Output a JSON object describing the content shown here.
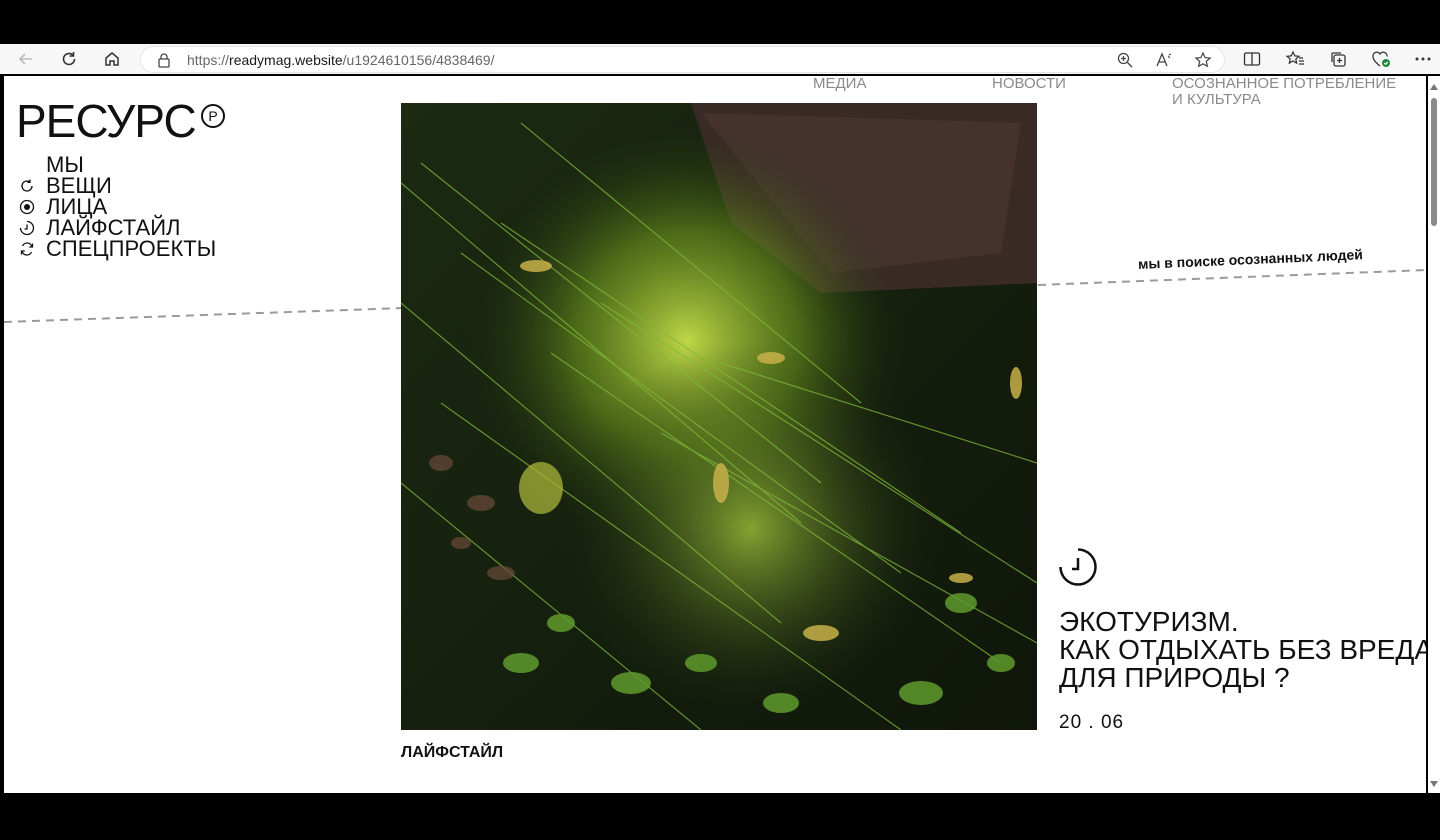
{
  "browser": {
    "url_prefix": "https://",
    "url_domain": "readymag.website",
    "url_path": "/u1924610156/4838469/",
    "icons": [
      "back-icon",
      "reload-icon",
      "home-icon",
      "lock-icon",
      "zoom-icon",
      "read-aloud-icon",
      "favorite-star-icon",
      "split-screen-icon",
      "favorites-icon",
      "collections-icon",
      "browser-essentials-icon",
      "more-icon"
    ]
  },
  "site": {
    "logo": "РЕСУРС",
    "logo_mark": "P",
    "menu": [
      {
        "label": "МЫ",
        "icon": ""
      },
      {
        "label": "ВЕЩИ",
        "icon": "refresh-arc-icon"
      },
      {
        "label": "ЛИЦА",
        "icon": "target-dot-icon"
      },
      {
        "label": "ЛАЙФСТАЙЛ",
        "icon": "clock-icon"
      },
      {
        "label": "СПЕЦПРОЕКТЫ",
        "icon": "cycle-arrows-icon"
      }
    ],
    "top_nav": [
      {
        "label": "МЕДИА"
      },
      {
        "label": "НОВОСТИ"
      },
      {
        "label_line1": "ОСОЗНАННОЕ ПОТРЕБЛЕНИЕ",
        "label_line2": "И КУЛЬТУРА"
      }
    ],
    "tagline": "мы в поиске осознанных людей",
    "photo_caption": "ЛАЙФСТАЙЛ",
    "article": {
      "title_line1": "ЭКОТУРИЗМ.",
      "title_line2": "КАК ОТДЫХАТЬ БЕЗ ВРЕДА",
      "title_line3": "ДЛЯ ПРИРОДЫ ?",
      "date": "20 . 06"
    }
  },
  "colors": {
    "nav_gray": "#8a8a8a",
    "text": "#111111",
    "dashed_line": "#9a9a9a"
  }
}
